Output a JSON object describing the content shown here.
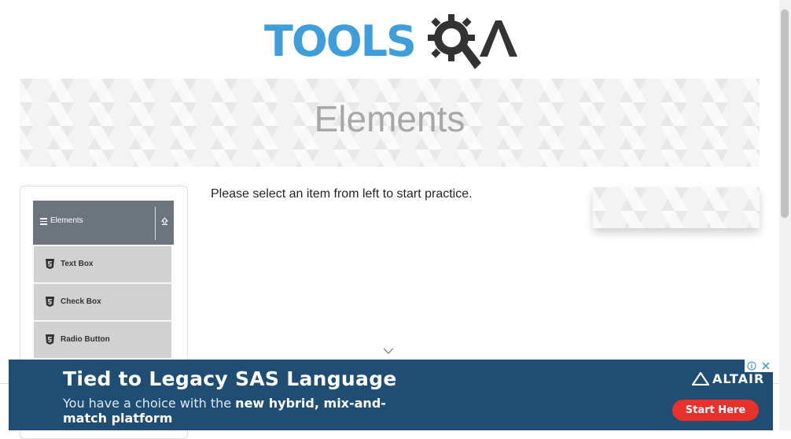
{
  "logo": {
    "word": "TOOLS",
    "qa": "QA"
  },
  "banner": {
    "title": "Elements"
  },
  "sidebar": {
    "group": {
      "label": "Elements"
    },
    "items": [
      {
        "label": "Text Box"
      },
      {
        "label": "Check Box"
      },
      {
        "label": "Radio Button"
      }
    ]
  },
  "main": {
    "instruction": "Please select an item from left to start practice."
  },
  "ad": {
    "headline": "Tied to Legacy SAS Language",
    "body_start": "You have a choice with the ",
    "body_bold": "new hybrid, mix-and-match platform",
    "brand": "ALTAIR",
    "cta": "Start Here"
  },
  "colors": {
    "brand_blue": "#3d9ed9",
    "group_header_bg": "#6c757d",
    "menu_item_bg": "#d1d1d1",
    "ad_bg": "#1f4d73",
    "ad_cta_bg": "#e8312a"
  }
}
